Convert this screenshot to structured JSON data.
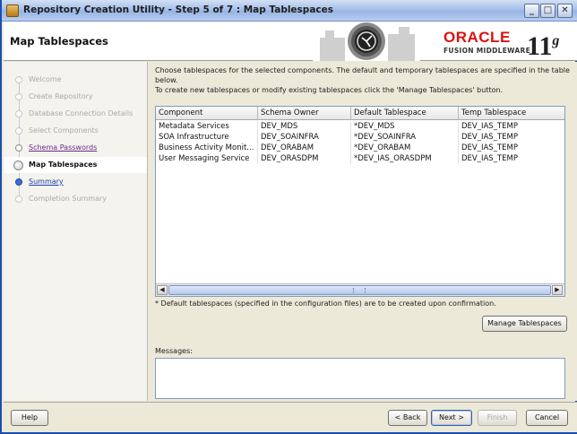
{
  "window": {
    "title": "Repository Creation Utility - Step 5 of 7 : Map Tablespaces"
  },
  "header": {
    "title": "Map Tablespaces",
    "brand": "ORACLE",
    "product": "FUSION MIDDLEWARE",
    "version_number": "11",
    "version_suffix": "g"
  },
  "nav": {
    "items": [
      {
        "label": "Welcome",
        "state": "done"
      },
      {
        "label": "Create Repository",
        "state": "done"
      },
      {
        "label": "Database Connection Details",
        "state": "done"
      },
      {
        "label": "Select Components",
        "state": "done"
      },
      {
        "label": "Schema Passwords",
        "state": "link"
      },
      {
        "label": "Map Tablespaces",
        "state": "current"
      },
      {
        "label": "Summary",
        "state": "next"
      },
      {
        "label": "Completion Summary",
        "state": "pending"
      }
    ]
  },
  "main": {
    "description_line1": "Choose tablespaces for the selected components. The default and temporary tablespaces are specified in the table below.",
    "description_line2": "To create new tablespaces or modify existing tablespaces click the 'Manage Tablespaces' button.",
    "table": {
      "columns": [
        "Component",
        "Schema Owner",
        "Default Tablespace",
        "Temp Tablespace"
      ],
      "rows": [
        [
          "Metadata Services",
          "DEV_MDS",
          "*DEV_MDS",
          "DEV_IAS_TEMP"
        ],
        [
          "SOA Infrastructure",
          "DEV_SOAINFRA",
          "*DEV_SOAINFRA",
          "DEV_IAS_TEMP"
        ],
        [
          "Business Activity Monit...",
          "DEV_ORABAM",
          "*DEV_ORABAM",
          "DEV_IAS_TEMP"
        ],
        [
          "User Messaging Service",
          "DEV_ORASDPM",
          "*DEV_IAS_ORASDPM",
          "DEV_IAS_TEMP"
        ]
      ]
    },
    "footnote": "* Default tablespaces (specified in the configuration files) are to be created upon confirmation.",
    "manage_button": "Manage Tablespaces",
    "messages_label": "Messages:"
  },
  "footer": {
    "help": "Help",
    "back": "< Back",
    "next": "Next >",
    "finish": "Finish",
    "cancel": "Cancel"
  }
}
